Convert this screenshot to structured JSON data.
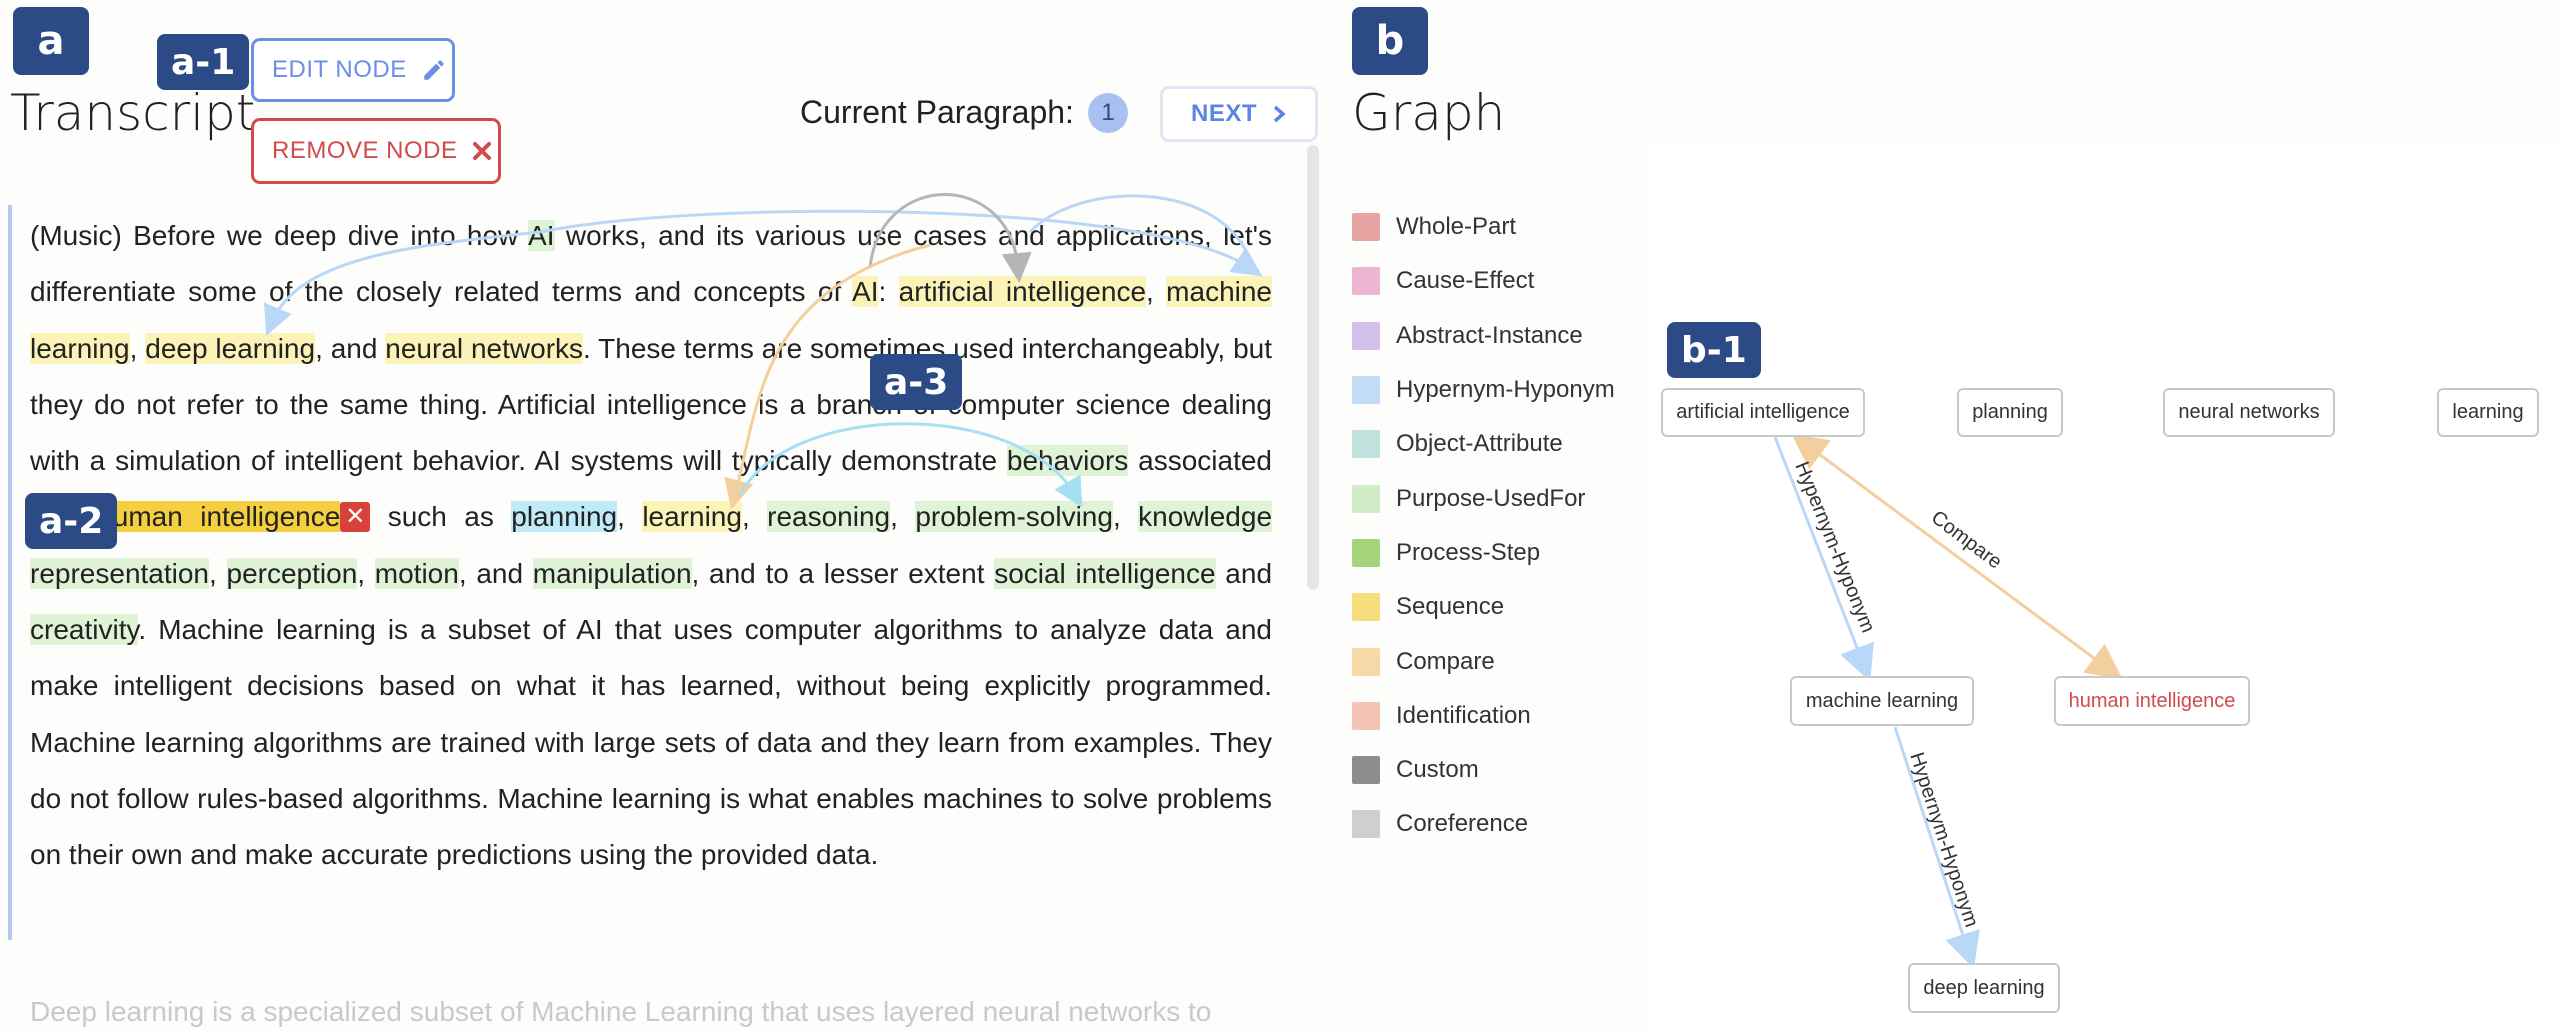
{
  "tags": {
    "a": "a",
    "a1": "a-1",
    "a2": "a-2",
    "a3": "a-3",
    "b": "b",
    "b1": "b-1"
  },
  "transcript": {
    "title": "Transcript"
  },
  "buttons": {
    "edit_node": "EDIT NODE",
    "remove_node": "REMOVE NODE",
    "next": "NEXT"
  },
  "paragraph": {
    "label": "Current Paragraph:",
    "number": "1"
  },
  "text": {
    "p01": "(Music) Before we deep dive into how ",
    "ai1": "AI",
    "p02": " works, and its various use cases and applications, let's differentiate some of the closely related terms and concepts of ",
    "ai2": "AI",
    "p03": ": ",
    "artificial_intelligence": "artificial intelligence",
    "p04": ", ",
    "machine_learning": "machine learning",
    "p05": ", ",
    "deep_learning": "deep learning",
    "p06": ", and ",
    "neural_networks": "neural networks",
    "p07": ". These terms are sometimes used interchangeably, but they do not refer to the same thing. Artificial intelligence is a branch of computer science dealing with a simulation of intelligent behavior. AI systems will typically demonstrate ",
    "behaviors": "behaviors",
    "p08": " associated with ",
    "human_intelligence": "human intelligence",
    "p09": " such as ",
    "planning": "planning",
    "p10": ", ",
    "learning": "learning",
    "p11": ", ",
    "reasoning": "reasoning",
    "p12": ", ",
    "problem_solving": "problem-solving",
    "p13": ", ",
    "knowledge_representation": "knowledge representation",
    "p14": ", ",
    "perception": "perception",
    "p15": ", ",
    "motion": "motion",
    "p16": ", and ",
    "manipulation": "manipulation",
    "p17": ", and to a lesser extent ",
    "social_intelligence": "social intelligence",
    "p18": " and ",
    "creativity": "creativity",
    "p19": ". Machine learning is a subset of AI that uses computer algorithms to analyze data and make intelligent decisions based on what it has learned, without being explicitly programmed. Machine learning algorithms are trained with large sets of data and they learn from examples. They do not follow rules-based algorithms. Machine learning is what enables machines to solve problems on their own and make accurate predictions using the provided data.",
    "next_paragraph": "Deep learning is a specialized subset of Machine Learning that uses layered neural networks to"
  },
  "graph": {
    "title": "Graph",
    "legend": [
      {
        "label": "Whole-Part",
        "color": "#e8a3a3"
      },
      {
        "label": "Cause-Effect",
        "color": "#ecb6d3"
      },
      {
        "label": "Abstract-Instance",
        "color": "#d5c0ec"
      },
      {
        "label": "Hypernym-Hyponym",
        "color": "#c2dcf8"
      },
      {
        "label": "Object-Attribute",
        "color": "#bfe3dc"
      },
      {
        "label": "Purpose-UsedFor",
        "color": "#d0ecc8"
      },
      {
        "label": "Process-Step",
        "color": "#a6d47c"
      },
      {
        "label": "Sequence",
        "color": "#f6de7c"
      },
      {
        "label": "Compare",
        "color": "#f7d9a8"
      },
      {
        "label": "Identification",
        "color": "#f3c3b4"
      },
      {
        "label": "Custom",
        "color": "#8d8d8d"
      },
      {
        "label": "Coreference",
        "color": "#cfcfcf"
      }
    ],
    "nodes": {
      "artificial_intelligence": "artificial intelligence",
      "planning": "planning",
      "neural_networks": "neural networks",
      "learning": "learning",
      "machine_learning": "machine learning",
      "human_intelligence": "human intelligence",
      "deep_learning": "deep learning"
    },
    "edges": {
      "e1": "Hypernym-Hyponym",
      "e2": "Compare",
      "e3": "Hypernym-Hyponym"
    }
  }
}
